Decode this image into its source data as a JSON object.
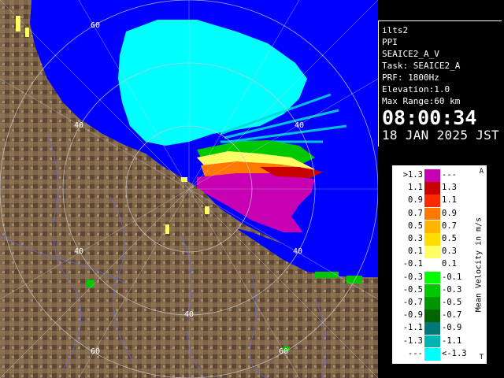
{
  "radar": {
    "range_rings_labels": [
      {
        "text": "60"
      },
      {
        "text": "40"
      },
      {
        "text": "40"
      },
      {
        "text": "40"
      },
      {
        "text": "40"
      },
      {
        "text": "60"
      },
      {
        "text": "60"
      }
    ]
  },
  "info": {
    "site": "ilts2",
    "scan_type": "PPI",
    "product": "SEAICE2_A_V",
    "task": "Task: SEAICE2_A",
    "prf": "PRF: 1800Hz",
    "elevation": "Elevation:1.0",
    "max_range": "Max Range:60 km",
    "time": "08:00:34",
    "date": "18 JAN 2025 JST"
  },
  "legend": {
    "title": "Mean Velocity in m/s",
    "rows": [
      {
        "hi": ">1.3",
        "lo": "---",
        "color": "#c800b4"
      },
      {
        "hi": "1.1",
        "lo": "1.3",
        "color": "#c80000"
      },
      {
        "hi": "0.9",
        "lo": "1.1",
        "color": "#ff2800"
      },
      {
        "hi": "0.7",
        "lo": "0.9",
        "color": "#ff7800"
      },
      {
        "hi": "0.5",
        "lo": "0.7",
        "color": "#ffb400"
      },
      {
        "hi": "0.3",
        "lo": "0.5",
        "color": "#ffdc00"
      },
      {
        "hi": "0.1",
        "lo": "0.3",
        "color": "#ffff64"
      },
      {
        "hi": "-0.1",
        "lo": "0.1",
        "color": "#ffffff"
      },
      {
        "hi": "-0.3",
        "lo": "-0.1",
        "color": "#00ff00"
      },
      {
        "hi": "-0.5",
        "lo": "-0.3",
        "color": "#00c800"
      },
      {
        "hi": "-0.7",
        "lo": "-0.5",
        "color": "#009600"
      },
      {
        "hi": "-0.9",
        "lo": "-0.7",
        "color": "#006400"
      },
      {
        "hi": "-1.1",
        "lo": "-0.9",
        "color": "#007878"
      },
      {
        "hi": "-1.3",
        "lo": "-1.1",
        "color": "#00b4b4"
      },
      {
        "hi": "---",
        "lo": "<-1.3",
        "color": "#00ffff"
      }
    ],
    "arrow_top": "A",
    "arrow_bottom": "T"
  },
  "colors": {
    "sea": "#0000ff",
    "ice": "#00ffff",
    "land": "#7a6248"
  }
}
